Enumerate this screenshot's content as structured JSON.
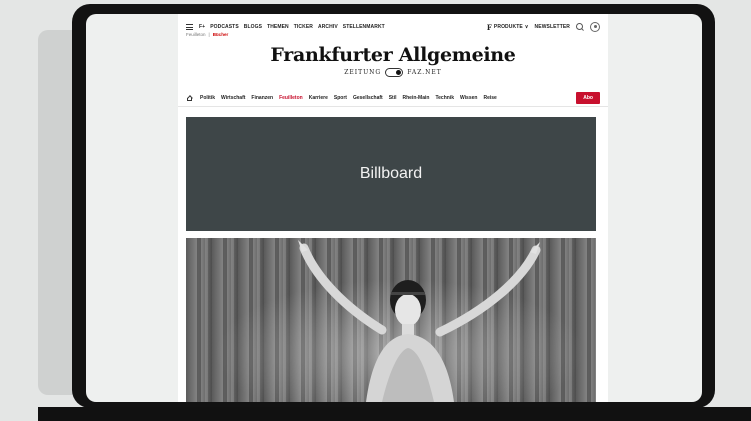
{
  "topnav": {
    "plus_label": "F+",
    "items": [
      "PODCASTS",
      "BLOGS",
      "THEMEN",
      "TICKER",
      "ARCHIV",
      "STELLENMARKT"
    ],
    "produkte_logo": "F",
    "produkte_label": "PRODUKTE",
    "newsletter_label": "NEWSLETTER"
  },
  "breadcrumb": {
    "parent": "Feuilleton",
    "separator": "|",
    "current": "Bücher"
  },
  "masthead": {
    "title": "Frankfurter Allgemeine",
    "zeitung": "ZEITUNG",
    "faznet": "FAZ.NET"
  },
  "sections": {
    "items": [
      "Politik",
      "Wirtschaft",
      "Finanzen",
      "Feuilleton",
      "Karriere",
      "Sport",
      "Gesellschaft",
      "Stil",
      "Rhein-Main",
      "Technik",
      "Wissen",
      "Reise"
    ],
    "active_index": 3,
    "abo_label": "Abo"
  },
  "billboard": {
    "label": "Billboard"
  },
  "colors": {
    "accent": "#c8102e",
    "billboard_bg": "#3e4648"
  }
}
